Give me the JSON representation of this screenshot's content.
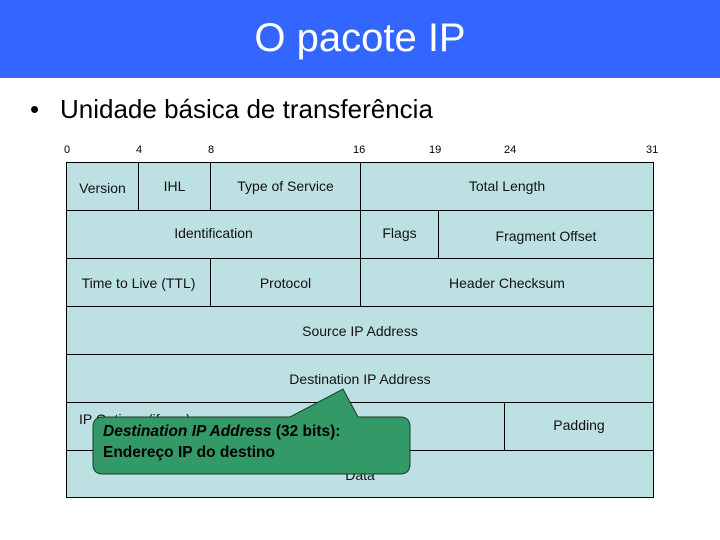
{
  "slide": {
    "title": "O pacote IP",
    "bullet": "Unidade básica de transferência",
    "colors": {
      "header": "#3366FF",
      "field_fill": "#BDE0E3",
      "callout_fill": "#339966"
    }
  },
  "bit_labels": [
    "0",
    "4",
    "8",
    "16",
    "19",
    "24",
    "31"
  ],
  "fields": {
    "version": "Version",
    "ihl": "IHL",
    "tos": "Type of Service",
    "total_length": "Total Length",
    "identification": "Identification",
    "flags": "Flags",
    "fragment_offset": "Fragment Offset",
    "ttl": "Time to Live (TTL)",
    "protocol": "Protocol",
    "header_checksum": "Header Checksum",
    "source_ip": "Source IP Address",
    "destination_ip": "Destination IP Address",
    "ip_options": "IP Options (if any)",
    "padding": "Padding",
    "data": "Data"
  },
  "callout": {
    "term": "Destination IP Address",
    "suffix": " (32 bits):",
    "description": "Endereço IP do destino"
  }
}
